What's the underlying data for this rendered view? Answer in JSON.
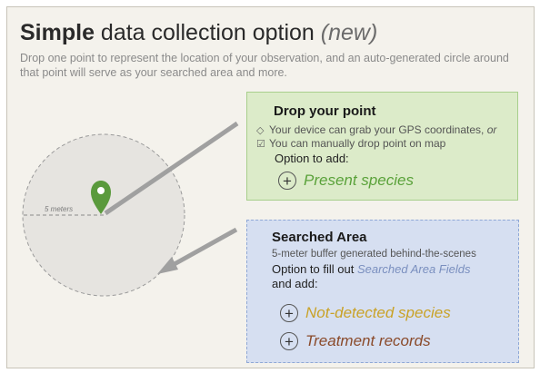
{
  "title": {
    "bold": "Simple",
    "regular": " data collection option ",
    "italic": "(new)"
  },
  "subtitle": "Drop one point  to represent the location of your observation, and an auto-generated circle around that point will serve as your searched area and more.",
  "diagram": {
    "scale_label": "5 meters"
  },
  "drop_point": {
    "title": "Drop your point",
    "gps_line": "Your device can grab your GPS coordinates, ",
    "gps_or": "or",
    "manual_line": "You can manually drop point on map",
    "option_label": "Option to add:",
    "option_1": "Present species"
  },
  "searched_area": {
    "title": "Searched Area",
    "buffer_line": "5-meter buffer generated behind-the-scenes",
    "fill_prefix": "Option to fill out ",
    "fill_link": "Searched Area Fields",
    "and_add": "and add:",
    "option_1": "Not-detected species",
    "option_2": "Treatment records"
  },
  "colors": {
    "point_green": "#5a9a3c",
    "present_species": "#5aa23a",
    "not_detected": "#c9a227",
    "treatment": "#8a4a2a",
    "link_blue": "#7a8fbf"
  },
  "icons": {
    "gps": "diamond-icon",
    "manual": "checkbox-icon",
    "add": "plus-circle-icon",
    "marker": "map-pin-icon"
  }
}
